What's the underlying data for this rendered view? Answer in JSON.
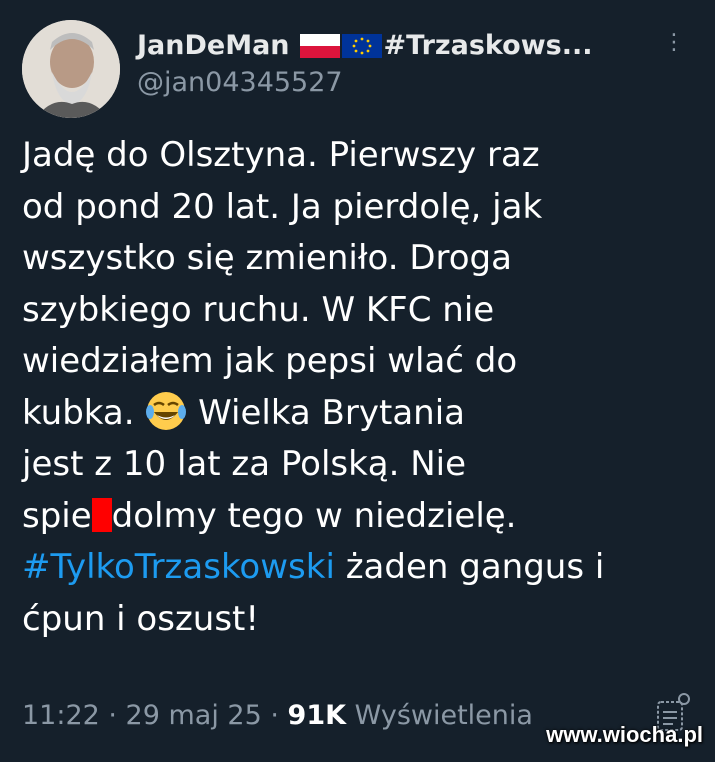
{
  "user": {
    "display_name": "JanDeMan",
    "name_hashtag": "#Trzaskows...",
    "handle": "@jan04345527"
  },
  "tweet": {
    "lines": [
      "Jadę do Olsztyna. Pierwszy raz",
      "od pond 20 lat. Ja pierdolę, jak",
      "wszystko się zmieniło. Droga",
      "szybkiego ruchu. W KFC nie",
      "wiedziałem jak pepsi wlać do",
      "kubka.",
      "Wielka Brytania",
      "jest z 10 lat za Polską. Nie",
      "spie",
      "dolmy tego w niedzielę.",
      "#TylkoTrzaskowski",
      " żaden gangus i",
      "ćpun i oszust!"
    ],
    "emoji": "face-with-tears-of-joy",
    "hashtag_color": "#1d9bf0"
  },
  "meta": {
    "time": "11:22 · 29 maj 25 · ",
    "views_count": "91K",
    "views_label": " Wyświetlenia"
  },
  "watermark": "www.wiocha.pl",
  "colors": {
    "background": "#15202b",
    "text": "#ffffff",
    "muted": "#8b98a5",
    "censor": "#ff0000"
  }
}
